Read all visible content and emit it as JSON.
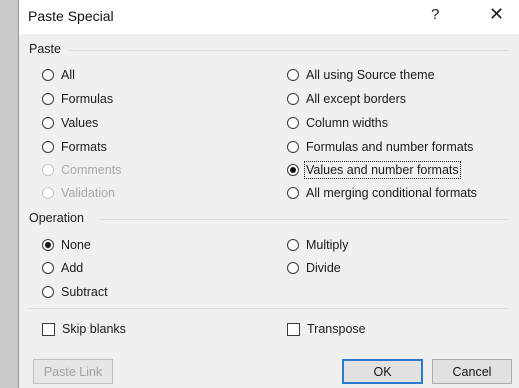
{
  "window": {
    "title": "Paste Special",
    "help_label": "?",
    "close_label": "✕"
  },
  "paste_group": {
    "label": "Paste",
    "left_options": [
      {
        "label": "All",
        "checked": false,
        "disabled": false
      },
      {
        "label": "Formulas",
        "checked": false,
        "disabled": false
      },
      {
        "label": "Values",
        "checked": false,
        "disabled": false
      },
      {
        "label": "Formats",
        "checked": false,
        "disabled": false
      },
      {
        "label": "Comments",
        "checked": false,
        "disabled": true
      },
      {
        "label": "Validation",
        "checked": false,
        "disabled": true
      }
    ],
    "right_options": [
      {
        "label": "All using Source theme",
        "checked": false,
        "disabled": false
      },
      {
        "label": "All except borders",
        "checked": false,
        "disabled": false
      },
      {
        "label": "Column widths",
        "checked": false,
        "disabled": false
      },
      {
        "label": "Formulas and number formats",
        "checked": false,
        "disabled": false
      },
      {
        "label": "Values and number formats",
        "checked": true,
        "disabled": false
      },
      {
        "label": "All merging conditional formats",
        "checked": false,
        "disabled": false
      }
    ]
  },
  "operation_group": {
    "label": "Operation",
    "left_options": [
      {
        "label": "None",
        "checked": true
      },
      {
        "label": "Add",
        "checked": false
      },
      {
        "label": "Subtract",
        "checked": false
      }
    ],
    "right_options": [
      {
        "label": "Multiply",
        "checked": false
      },
      {
        "label": "Divide",
        "checked": false
      }
    ]
  },
  "checkboxes": {
    "skip_blanks": "Skip blanks",
    "transpose": "Transpose"
  },
  "buttons": {
    "paste_link": "Paste Link",
    "ok": "OK",
    "cancel": "Cancel"
  }
}
